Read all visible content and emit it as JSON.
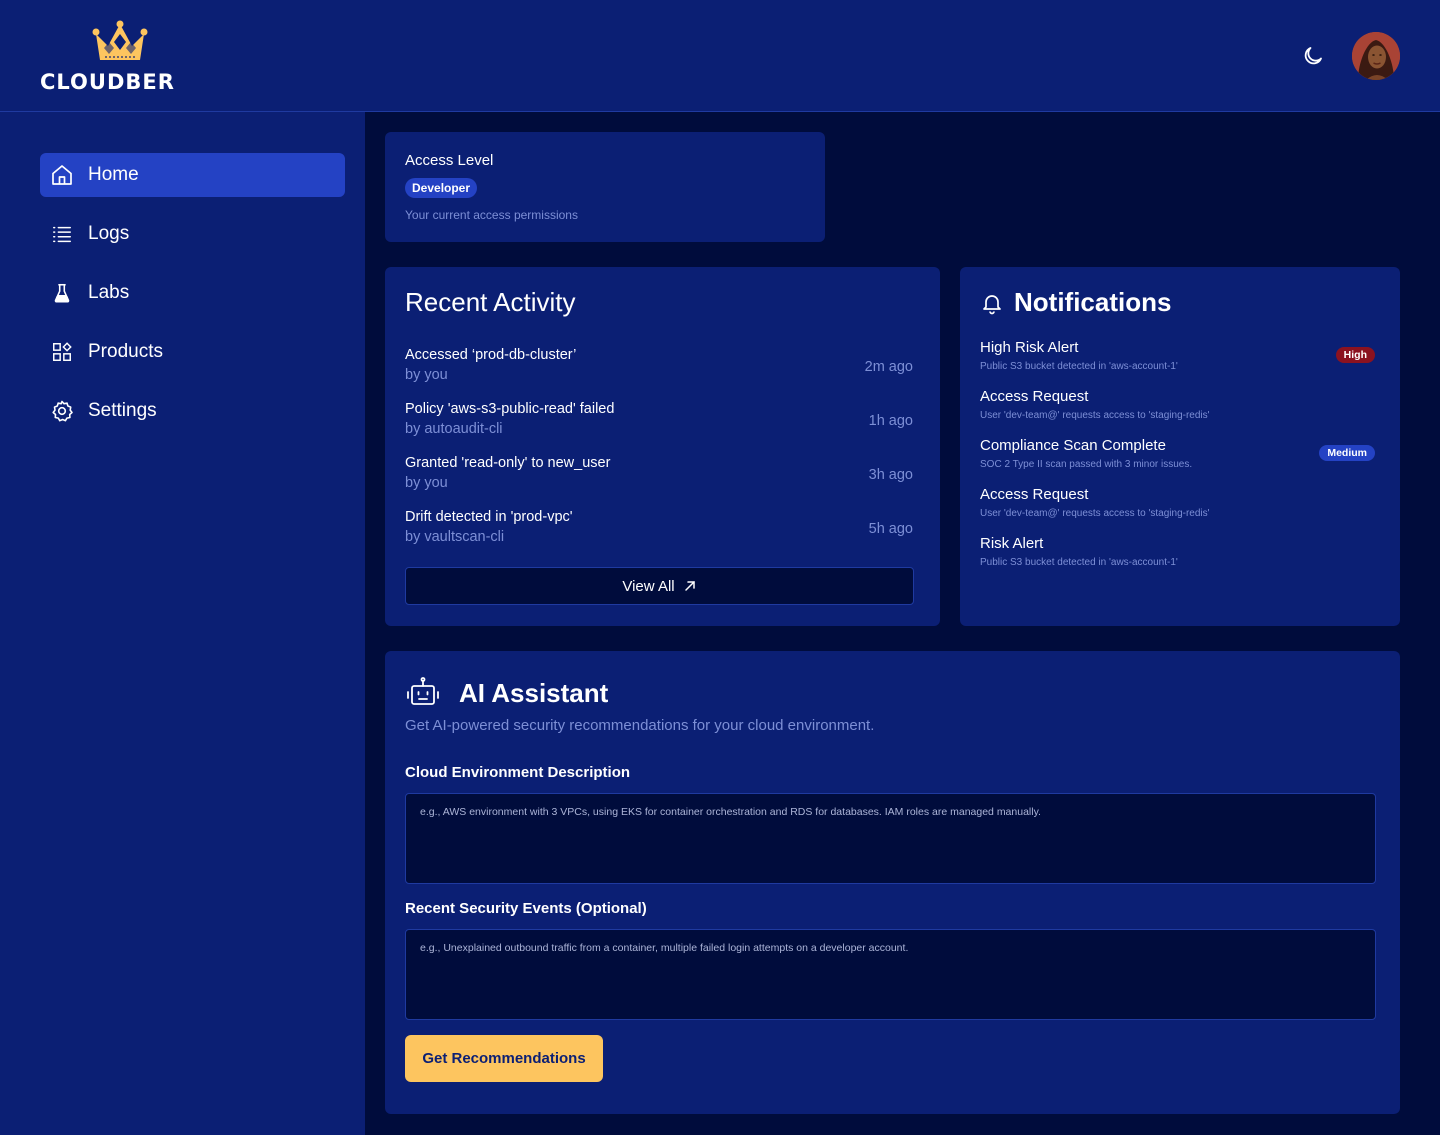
{
  "brand": {
    "name": "CLOUDBER",
    "accent": "#fdc55f",
    "primary": "#2442c4"
  },
  "header": {
    "theme_toggle": "moon-icon",
    "avatar": "user-avatar"
  },
  "sidebar": {
    "items": [
      {
        "label": "Home",
        "icon": "home-icon",
        "active": true
      },
      {
        "label": "Logs",
        "icon": "list-icon",
        "active": false
      },
      {
        "label": "Labs",
        "icon": "flask-icon",
        "active": false
      },
      {
        "label": "Products",
        "icon": "grid-icon",
        "active": false
      },
      {
        "label": "Settings",
        "icon": "gear-icon",
        "active": false
      }
    ]
  },
  "access": {
    "title": "Access Level",
    "level": "Developer",
    "subtitle": "Your current access permissions"
  },
  "activity": {
    "title": "Recent Activity",
    "items": [
      {
        "action": "Accessed ‘prod-db-cluster’",
        "by": "by you",
        "time": "2m ago"
      },
      {
        "action": "Policy 'aws-s3-public-read' failed",
        "by": "by autoaudit-cli",
        "time": "1h ago"
      },
      {
        "action": "Granted 'read-only' to new_user",
        "by": "by you",
        "time": "3h ago"
      },
      {
        "action": "Drift detected in 'prod-vpc'",
        "by": "by vaultscan-cli",
        "time": "5h ago"
      }
    ],
    "view_all": "View All"
  },
  "notifications": {
    "title": "Notifications",
    "items": [
      {
        "title": "High Risk Alert",
        "desc": "Public S3 bucket detected in 'aws-account-1'",
        "badge": "High"
      },
      {
        "title": "Access Request",
        "desc": "User 'dev-team@' requests access to 'staging-redis'",
        "badge": ""
      },
      {
        "title": "Compliance Scan Complete",
        "desc": "SOC 2 Type II scan passed with 3 minor issues.",
        "badge": "Medium"
      },
      {
        "title": "Access Request",
        "desc": "User 'dev-team@' requests access to 'staging-redis'",
        "badge": ""
      },
      {
        "title": "Risk Alert",
        "desc": "Public S3 bucket detected in 'aws-account-1'",
        "badge": ""
      }
    ]
  },
  "ai": {
    "title": "AI Assistant",
    "subtitle": "Get AI-powered security recommendations for your cloud environment.",
    "env_label": "Cloud Environment Description",
    "env_placeholder": "e.g., AWS environment with 3 VPCs, using EKS for container orchestration and RDS for databases. IAM roles are managed manually.",
    "events_label": "Recent Security Events (Optional)",
    "events_placeholder": "e.g., Unexplained outbound traffic from a container, multiple failed login attempts on a developer account.",
    "button": "Get Recommendations"
  }
}
